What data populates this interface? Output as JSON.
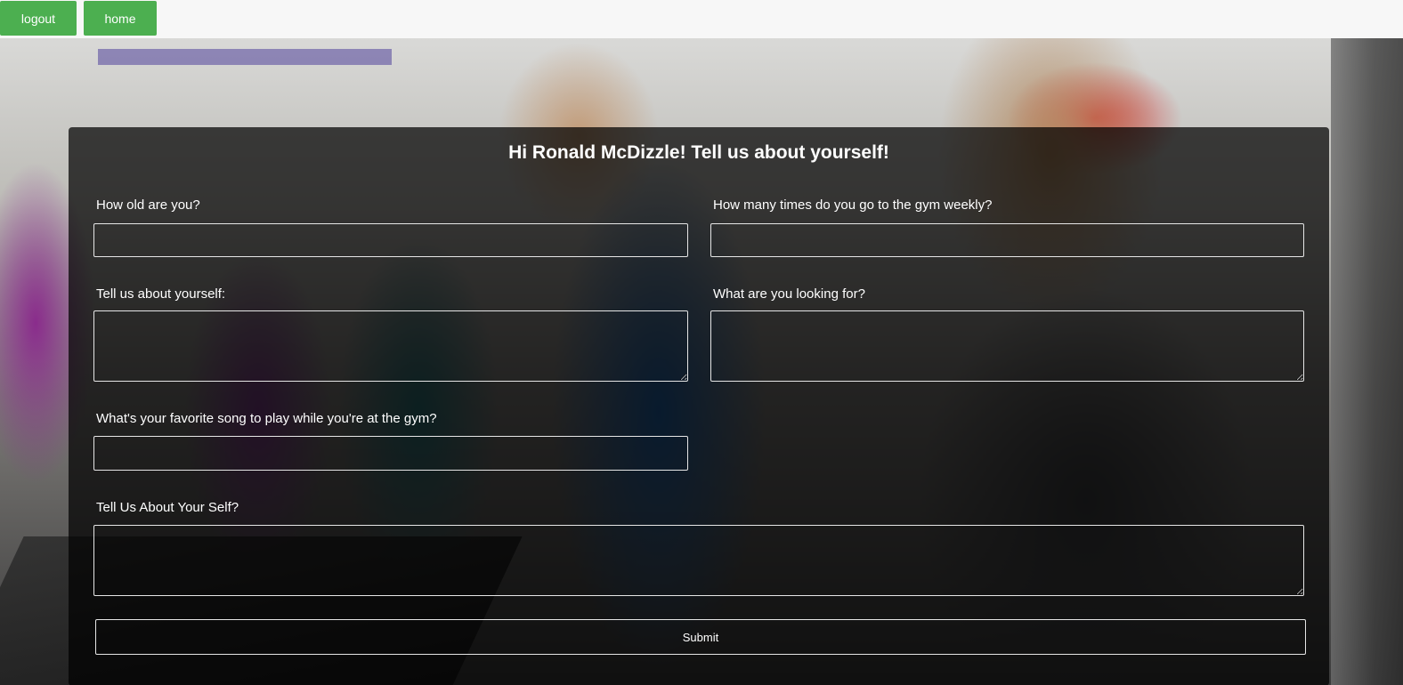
{
  "nav": {
    "logout_label": "logout",
    "home_label": "home",
    "button_color": "#4caf50"
  },
  "form": {
    "title": "Hi Ronald McDizzle! Tell us about yourself!",
    "fields": [
      {
        "label": "How old are you?",
        "value": ""
      },
      {
        "label": "How many times do you go to the gym weekly?",
        "value": ""
      },
      {
        "label": "Tell us about yourself:",
        "value": ""
      },
      {
        "label": "What are you looking for?",
        "value": ""
      },
      {
        "label": "What's your favorite song to play while you're at the gym?",
        "value": ""
      },
      {
        "label": "Tell Us About Your Self?",
        "value": ""
      }
    ],
    "submit_label": "Submit"
  }
}
